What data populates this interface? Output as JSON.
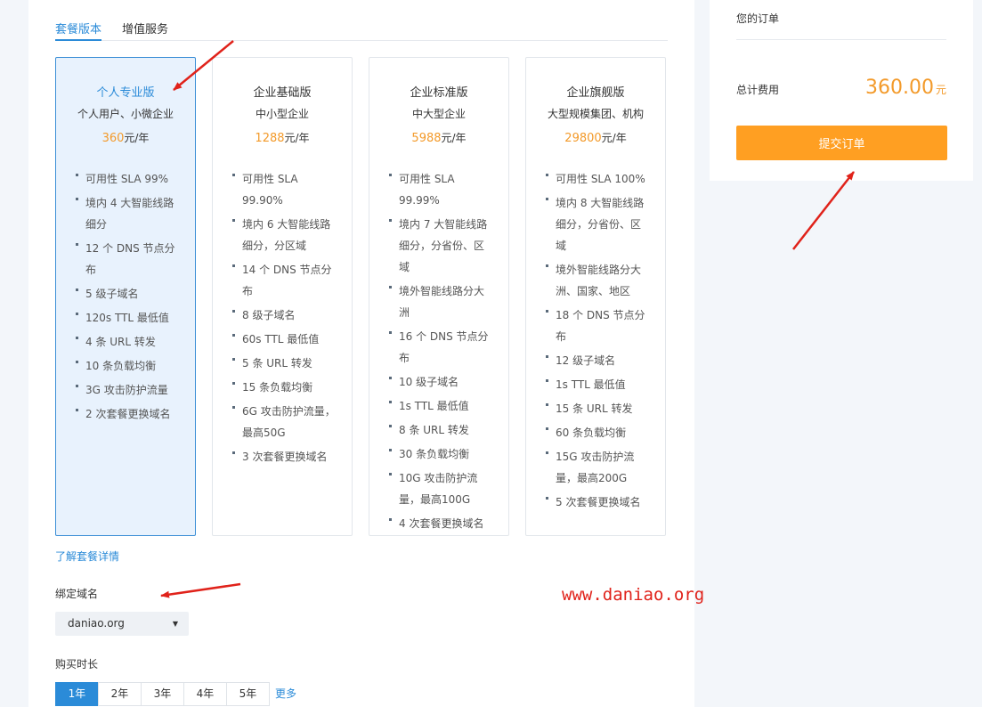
{
  "tabs": [
    {
      "label": "套餐版本",
      "active": true
    },
    {
      "label": "增值服务",
      "active": false
    }
  ],
  "plans": [
    {
      "name": "个人专业版",
      "subtitle": "个人用户、小微企业",
      "price": "360",
      "unit": "元/年",
      "selected": true,
      "features": [
        "可用性 SLA 99%",
        "境内 4 大智能线路细分",
        "12 个 DNS 节点分布",
        "5 级子域名",
        "120s TTL 最低值",
        "4 条 URL 转发",
        "10 条负载均衡",
        "3G 攻击防护流量",
        "2 次套餐更换域名"
      ]
    },
    {
      "name": "企业基础版",
      "subtitle": "中小型企业",
      "price": "1288",
      "unit": "元/年",
      "selected": false,
      "features": [
        "可用性 SLA 99.90%",
        "境内 6 大智能线路细分，分区域",
        "14 个 DNS 节点分布",
        "8 级子域名",
        "60s TTL 最低值",
        "5 条 URL 转发",
        "15 条负载均衡",
        "6G 攻击防护流量，最高50G",
        "3 次套餐更换域名"
      ]
    },
    {
      "name": "企业标准版",
      "subtitle": "中大型企业",
      "price": "5988",
      "unit": "元/年",
      "selected": false,
      "features": [
        "可用性 SLA 99.99%",
        "境内 7 大智能线路细分，分省份、区域",
        "境外智能线路分大洲",
        "16 个 DNS 节点分布",
        "10 级子域名",
        "1s TTL 最低值",
        "8 条 URL 转发",
        "30 条负载均衡",
        "10G 攻击防护流量，最高100G",
        "4 次套餐更换域名"
      ]
    },
    {
      "name": "企业旗舰版",
      "subtitle": "大型规模集团、机构",
      "price": "29800",
      "unit": "元/年",
      "selected": false,
      "features": [
        "可用性 SLA 100%",
        "境内 8 大智能线路细分，分省份、区域",
        "境外智能线路分大洲、国家、地区",
        "18 个 DNS 节点分布",
        "12 级子域名",
        "1s TTL 最低值",
        "15 条 URL 转发",
        "60 条负载均衡",
        "15G 攻击防护流量，最高200G",
        "5 次套餐更换域名"
      ]
    }
  ],
  "detail_link": "了解套餐详情",
  "domain": {
    "label": "绑定域名",
    "value": "daniao.org"
  },
  "duration": {
    "label": "购买时长",
    "options": [
      "1年",
      "2年",
      "3年",
      "4年",
      "5年"
    ],
    "selected_index": 0,
    "more": "更多"
  },
  "order": {
    "title": "您的订单",
    "total_label": "总计费用",
    "total_amount": "360.00",
    "currency": "元",
    "submit_label": "提交订单"
  },
  "watermark": "www.daniao.org",
  "colors": {
    "accent": "#2b8bd8",
    "price": "#f39a2a",
    "submit": "#ff9f22",
    "annotation": "#e0221a"
  }
}
